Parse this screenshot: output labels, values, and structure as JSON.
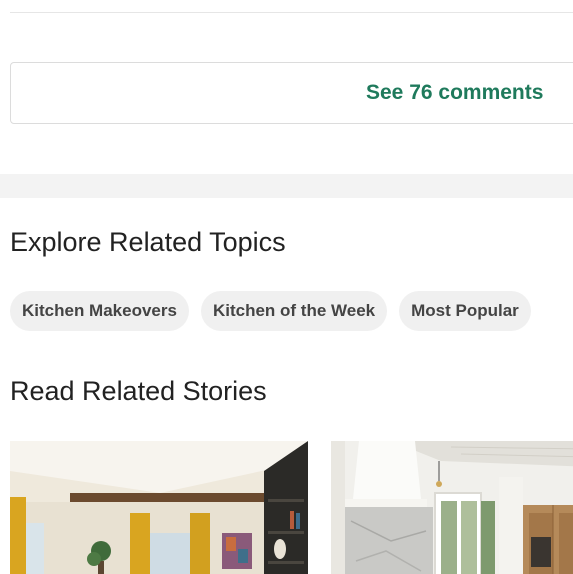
{
  "comments": {
    "link_label": "See 76 comments"
  },
  "related_topics": {
    "heading": "Explore Related Topics",
    "chips": [
      {
        "label": "Kitchen Makeovers"
      },
      {
        "label": "Kitchen of the Week"
      },
      {
        "label": "Most Popular"
      }
    ]
  },
  "related_stories": {
    "heading": "Read Related Stories",
    "cards": [
      {
        "image": "living-room-yellow-curtains-photo"
      },
      {
        "image": "white-kitchen-marble-backsplash-photo"
      }
    ]
  },
  "colors": {
    "accent": "#1f7a5c",
    "chip_bg": "#f0f0f0",
    "band_bg": "#f3f3f3"
  }
}
